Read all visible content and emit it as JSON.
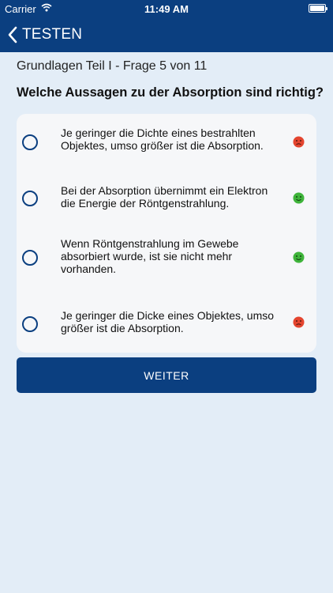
{
  "status_bar": {
    "carrier": "Carrier",
    "time": "11:49 AM"
  },
  "nav": {
    "back_label": "TESTEN",
    "back_icon": "chevron-left-icon"
  },
  "quiz": {
    "progress": "Grundlagen Teil I - Frage 5 von 11",
    "question": "Welche Aussagen zu der Absorption sind richtig?",
    "answers": [
      {
        "text": "Je geringer die Dichte eines bestrahlten Objektes, umso größer ist die Absorption.",
        "feedback": "sad-face-icon",
        "feedback_color": "#e4452f"
      },
      {
        "text": "Bei der Absorption übernimmt ein Elektron die Energie der Röntgenstrahlung.",
        "feedback": "happy-face-icon",
        "feedback_color": "#3fb43b"
      },
      {
        "text": "Wenn Röntgenstrahlung im Gewebe absorbiert wurde, ist sie nicht mehr vorhanden.",
        "feedback": "happy-face-icon",
        "feedback_color": "#3fb43b"
      },
      {
        "text": "Je geringer die Dicke eines Objektes, umso größer ist die Absorption.",
        "feedback": "sad-face-icon",
        "feedback_color": "#e4452f"
      }
    ],
    "next_button": "WEITER"
  },
  "colors": {
    "primary": "#0b3f80",
    "background": "#e3edf7",
    "card": "#f6f7f9"
  }
}
